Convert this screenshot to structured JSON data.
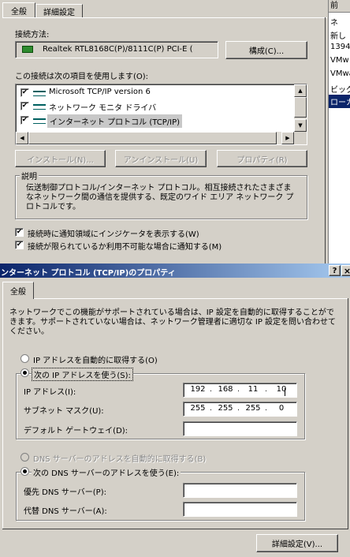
{
  "top_dialog": {
    "tabs": [
      {
        "label": "全般"
      },
      {
        "label": "詳細設定"
      }
    ],
    "connect_label": "接続方法:",
    "adapter_name": "Realtek RTL8168C(P)/8111C(P) PCI-E (",
    "configure_btn": "構成(C)...",
    "items_label": "この接続は次の項目を使用します(O):",
    "items": [
      {
        "label": "Microsoft TCP/IP version 6",
        "checked": "✔"
      },
      {
        "label": "ネットワーク モニタ ドライバ",
        "checked": "✔"
      },
      {
        "label": "インターネット プロトコル (TCP/IP)",
        "checked": "✔"
      }
    ],
    "install_btn": "インストール(N)...",
    "uninstall_btn": "アンインストール(U)",
    "properties_btn": "プロパティ(R)",
    "description_title": "説明",
    "description_text": "伝送制御プロトコル/インターネット プロトコル。相互接続されたさまざまなネットワーク間の通信を提供する、既定のワイド エリア ネットワーク プロトコルです。",
    "notify_icon_cb": {
      "label": "接続時に通知領域にインジケータを表示する(W)",
      "checked": "✔"
    },
    "notify_limited_cb": {
      "label": "接続が限られているか利用不可能な場合に通知する(M)",
      "checked": "✔"
    }
  },
  "side_list": {
    "header": "前",
    "items": [
      "ネ",
      "新し",
      "1394",
      "VMw",
      "VMwa",
      "ビッグ",
      "ローカ"
    ]
  },
  "props_dialog": {
    "title": "ンターネット プロトコル (TCP/IP)のプロパティ",
    "help_btn": "?",
    "close_btn": "×",
    "tab": "全般",
    "info_text": "ネットワークでこの機能がサポートされている場合は、IP 設定を自動的に取得することができます。サポートされていない場合は、ネットワーク管理者に適切な IP 設定を問い合わせてください。",
    "auto_ip_radio": "IP アドレスを自動的に取得する(O)",
    "manual_ip_radio": "次の IP アドレスを使う(S):",
    "ip_label": "IP アドレス(I):",
    "ip_value": [
      "192",
      "168",
      "11",
      "10"
    ],
    "mask_label": "サブネット マスク(U):",
    "mask_value": [
      "255",
      "255",
      "255",
      "0"
    ],
    "gateway_label": "デフォルト ゲートウェイ(D):",
    "auto_dns_radio": "DNS サーバーのアドレスを自動的に取得する(B)",
    "manual_dns_radio": "次の DNS サーバーのアドレスを使う(E):",
    "pref_dns_label": "優先 DNS サーバー(P):",
    "alt_dns_label": "代替 DNS サーバー(A):",
    "advanced_btn": "詳細設定(V)..."
  }
}
